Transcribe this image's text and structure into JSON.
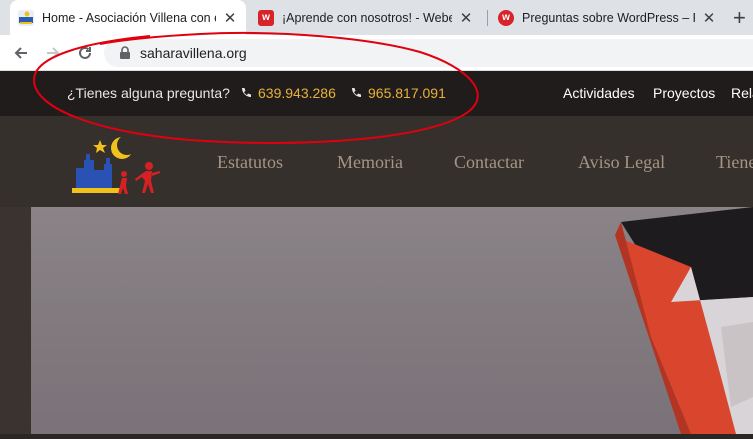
{
  "browser": {
    "tabs": [
      {
        "title": "Home - Asociación Villena con el",
        "active": true
      },
      {
        "title": "¡Aprende con nosotros! - Weben",
        "active": false
      },
      {
        "title": "Preguntas sobre WordPress – For",
        "active": false
      }
    ],
    "close_glyph": "✕",
    "new_tab_glyph": "+",
    "url": "saharavillena.org"
  },
  "site": {
    "topbar": {
      "question": "¿Tienes alguna pregunta?",
      "phone1": "639.943.286",
      "phone2": "965.817.091",
      "links": [
        "Actividades",
        "Proyectos",
        "Rela"
      ]
    },
    "nav": [
      "Estatutos",
      "Memoria",
      "Contactar",
      "Aviso Legal",
      "Tiene"
    ]
  },
  "colors": {
    "phone": "#e8b23a",
    "nav_text": "#a49586",
    "annotation": "#e0000f"
  }
}
